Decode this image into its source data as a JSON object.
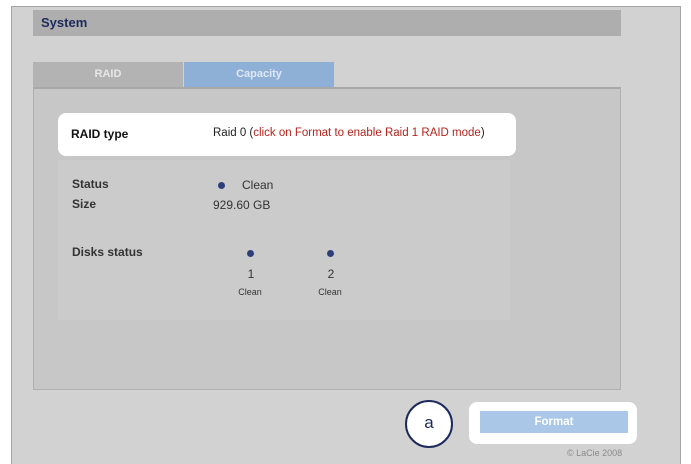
{
  "header": {
    "title": "System"
  },
  "tabs": [
    {
      "label": "RAID",
      "active": false
    },
    {
      "label": "Capacity",
      "active": true
    }
  ],
  "raid": {
    "label": "RAID type",
    "value_prefix": "Raid 0 (",
    "value_hint": "click on Format to enable Raid 1 RAID mode",
    "value_suffix": ")"
  },
  "status": {
    "label": "Status",
    "value": "Clean"
  },
  "size": {
    "label": "Size",
    "value": "929.60 GB"
  },
  "disks": {
    "label": "Disks status",
    "items": [
      {
        "number": "1",
        "state": "Clean"
      },
      {
        "number": "2",
        "state": "Clean"
      }
    ]
  },
  "callout": {
    "label": "a"
  },
  "actions": {
    "format_label": "Format"
  },
  "footer": {
    "copyright": "© LaCie 2008"
  },
  "colors": {
    "status_dot": "#2c3f7a",
    "hint_text": "#b3241e",
    "format_button": "#aac7e8",
    "active_tab": "#8fb0d6"
  }
}
